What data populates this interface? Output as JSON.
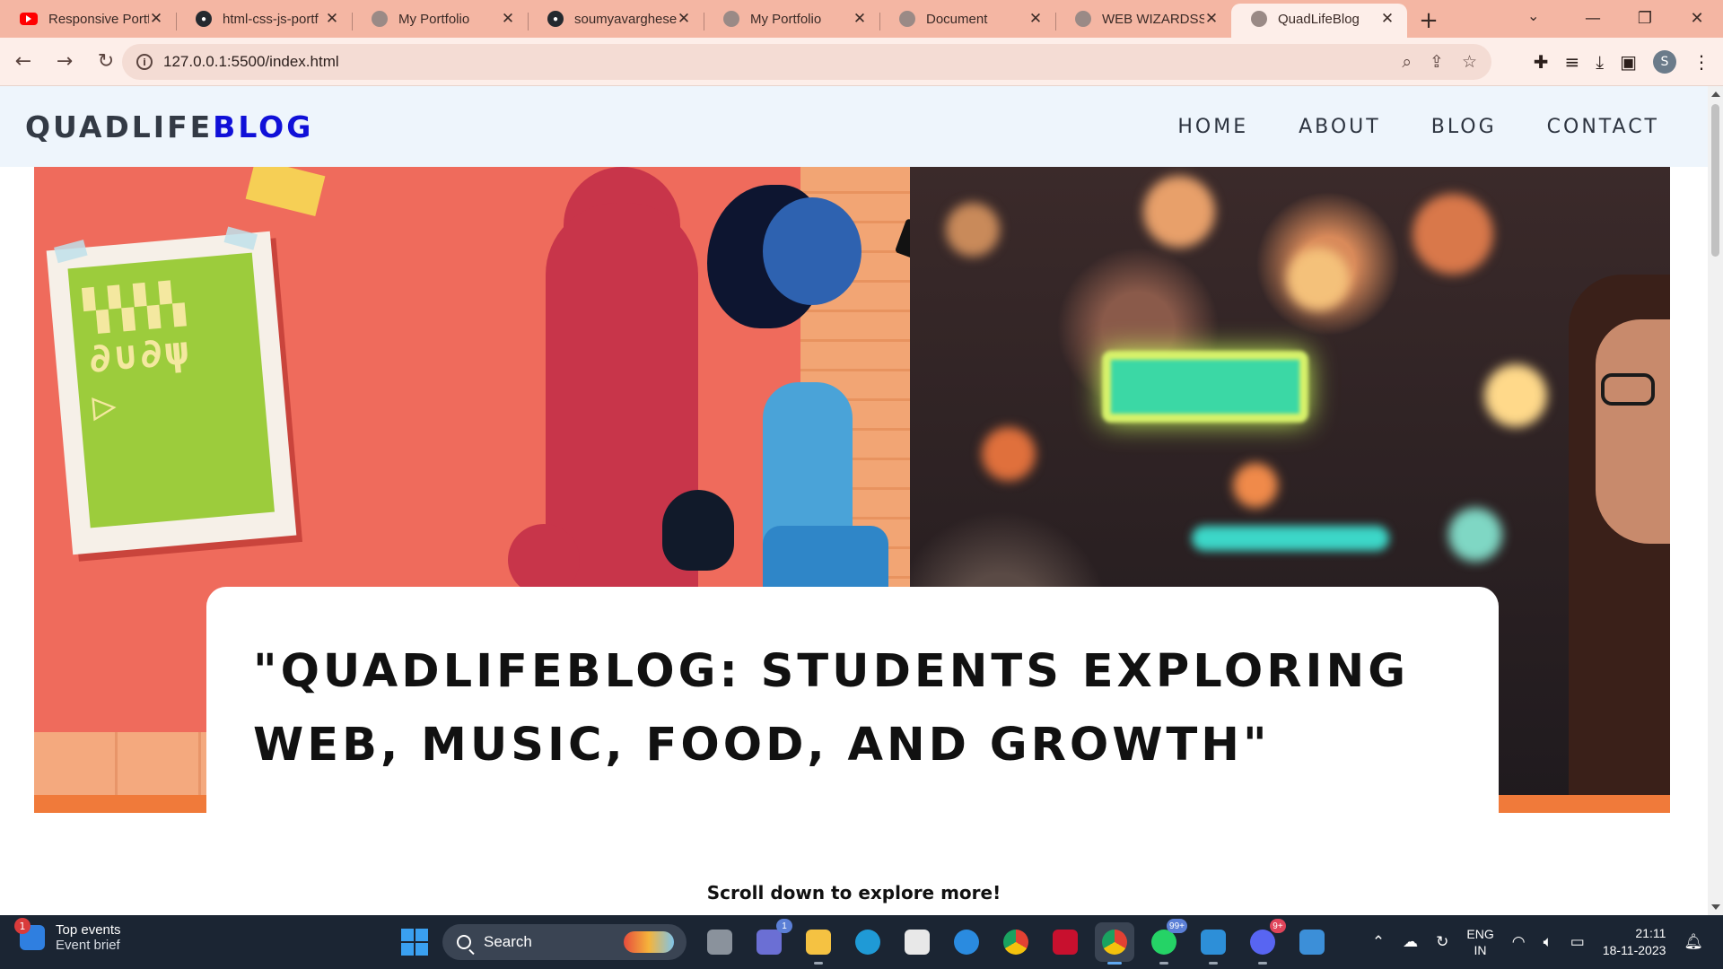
{
  "browser": {
    "tabs": [
      {
        "title": "Responsive Portf",
        "favicon": "youtube-icon"
      },
      {
        "title": "html-css-js-portf",
        "favicon": "github-icon"
      },
      {
        "title": "My Portfolio",
        "favicon": "globe-icon"
      },
      {
        "title": "soumyavarghese",
        "favicon": "github-icon"
      },
      {
        "title": "My Portfolio",
        "favicon": "globe-icon"
      },
      {
        "title": "Document",
        "favicon": "globe-icon"
      },
      {
        "title": "WEB WIZARDSS",
        "favicon": "globe-icon"
      },
      {
        "title": "QuadLifeBlog",
        "favicon": "globe-icon",
        "active": true
      }
    ],
    "url": "127.0.0.1:5500/index.html",
    "profile_initial": "S",
    "accent": "#f4b6a3"
  },
  "site": {
    "logo_part1": "QUADLIFE",
    "logo_part2": "BLOG",
    "logo_accent": "#1010d8",
    "nav": [
      "HOME",
      "ABOUT",
      "BLOG",
      "CONTACT"
    ],
    "hero_title": "\"QUADLIFEBLOG: STUDENTS EXPLORING WEB, MUSIC, FOOD, AND GROWTH\"",
    "scroll_hint": "Scroll down to explore more!"
  },
  "taskbar": {
    "weather_title": "Top events",
    "weather_subtitle": "Event brief",
    "weather_badge": "1",
    "search_placeholder": "Search",
    "badges": {
      "teams": "1",
      "whatsapp": "99+",
      "discord": "9+"
    },
    "lang_1": "ENG",
    "lang_2": "IN",
    "time": "21:11",
    "date": "18-11-2023"
  }
}
